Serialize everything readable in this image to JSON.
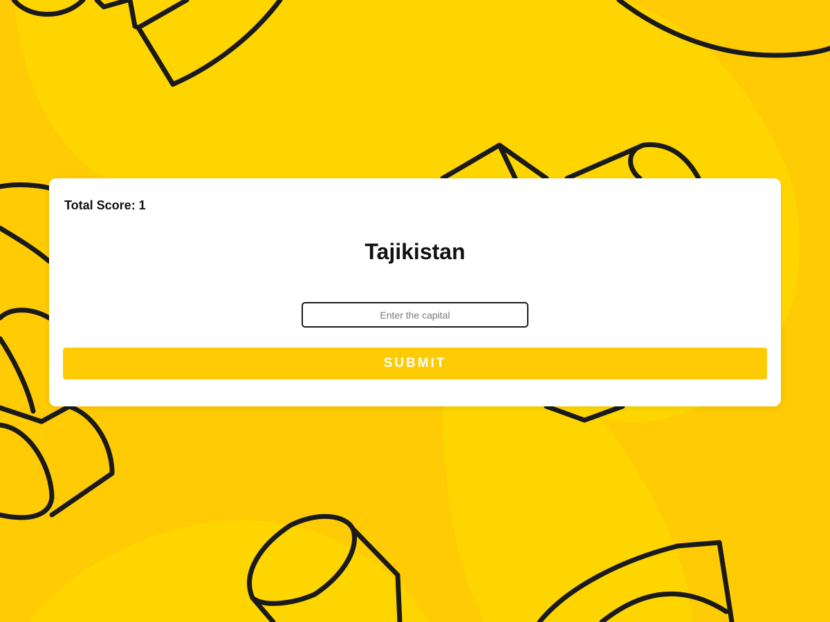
{
  "colors": {
    "background": "#ffcb05",
    "background_blob": "#ffd500",
    "outline": "#1a1a1a",
    "card": "#ffffff",
    "button": "#ffcb05",
    "button_text": "#ffffff"
  },
  "score": {
    "label": "Total Score: 1"
  },
  "question": {
    "country": "Tajikistan"
  },
  "answer": {
    "placeholder": "Enter the capital",
    "value": ""
  },
  "actions": {
    "submit_label": "SUBMIT"
  }
}
